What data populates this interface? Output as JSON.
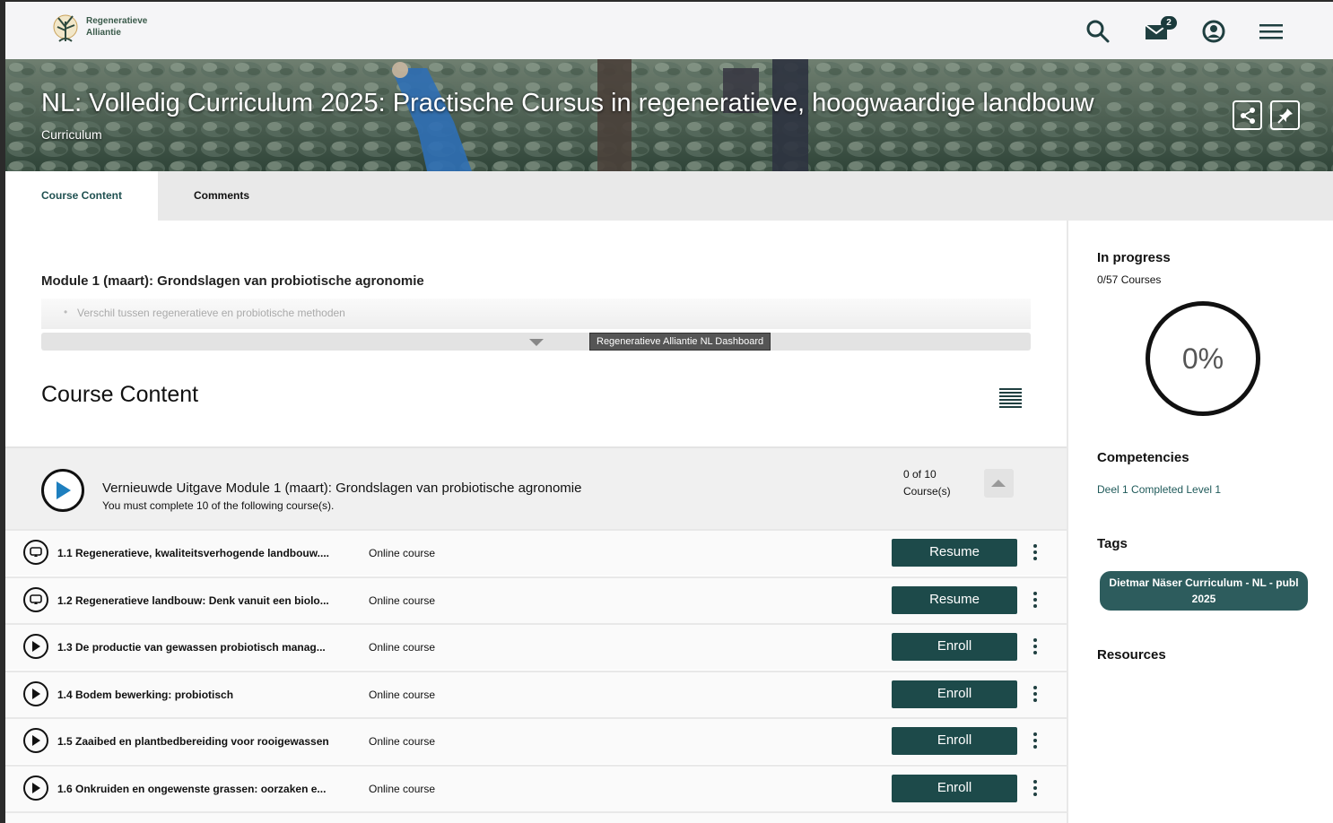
{
  "header": {
    "logo_line1": "Regeneratieve",
    "logo_line2": "Alliantie",
    "messages_badge": "2"
  },
  "hero": {
    "title": "NL: Volledig Curriculum 2025: Practische Cursus in regeneratieve, hoogwaardige landbouw",
    "subtitle": "Curriculum"
  },
  "tabs": [
    "Course Content",
    "Comments"
  ],
  "module": {
    "title": "Module 1 (maart): Grondslagen van probiotische agronomie",
    "description_item": "Verschil tussen regeneratieve en probiotische methoden",
    "tooltip": "Regeneratieve Alliantie NL Dashboard"
  },
  "content": {
    "heading": "Course Content",
    "group": {
      "title": "Vernieuwde Uitgave Module 1 (maart): Grondslagen van probiotische agronomie",
      "subtitle": "You must complete 10 of the following course(s).",
      "count_line1": "0 of 10",
      "count_line2": "Course(s)"
    },
    "rows": [
      {
        "title": "1.1 Regeneratieve, kwaliteitsverhogende landbouw....",
        "type": "Online course",
        "action": "Resume",
        "icon": "resume-icon"
      },
      {
        "title": "1.2 Regeneratieve landbouw: Denk vanuit een biolo...",
        "type": "Online course",
        "action": "Resume",
        "icon": "resume-icon"
      },
      {
        "title": "1.3 De productie van gewassen probiotisch manag...",
        "type": "Online course",
        "action": "Enroll",
        "icon": "play-icon"
      },
      {
        "title": "1.4 Bodem bewerking: probiotisch",
        "type": "Online course",
        "action": "Enroll",
        "icon": "play-icon"
      },
      {
        "title": "1.5 Zaaibed en plantbedbereiding voor rooigewassen",
        "type": "Online course",
        "action": "Enroll",
        "icon": "play-icon"
      },
      {
        "title": "1.6 Onkruiden en ongewenste grassen: oorzaken e...",
        "type": "Online course",
        "action": "Enroll",
        "icon": "play-icon"
      }
    ]
  },
  "sidebar": {
    "progress_heading": "In progress",
    "progress_sub": "0/57 Courses",
    "progress_percent": "0%",
    "competencies_heading": "Competencies",
    "competency": "Deel 1 Completed Level 1",
    "tags_heading": "Tags",
    "tag": "Dietmar Näser Curriculum - NL - publ 2025",
    "resources_heading": "Resources"
  },
  "colors": {
    "accent": "#1d4a4a",
    "tag_bg": "#2d5c5d"
  }
}
